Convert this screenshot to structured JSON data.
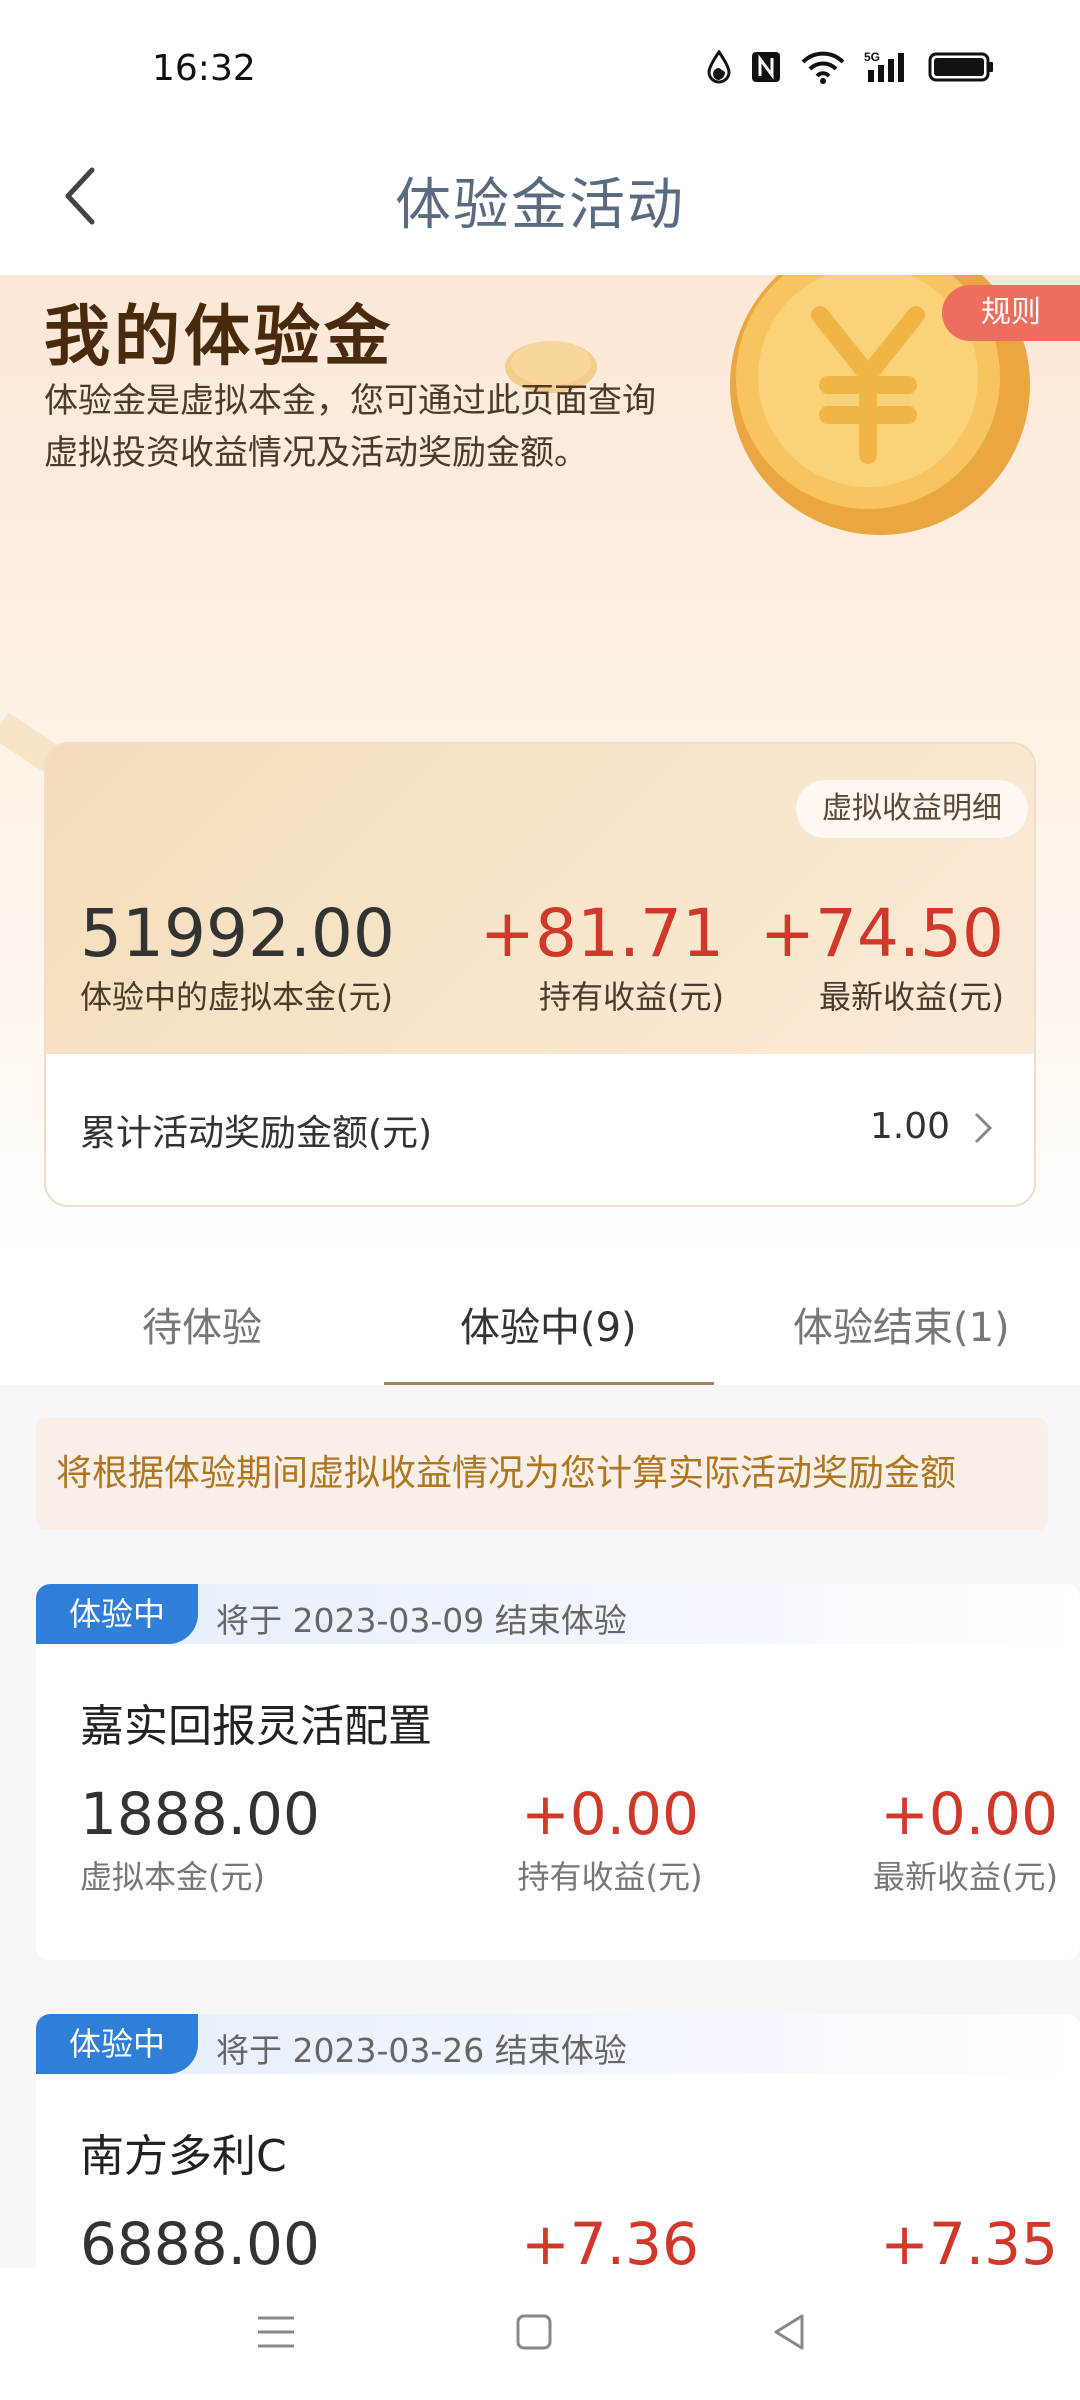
{
  "status_bar": {
    "time": "16:32"
  },
  "nav": {
    "title": "体验金活动"
  },
  "hero": {
    "title": "我的体验金",
    "description": "体验金是虚拟本金，您可通过此页面查询虚拟投资收益情况及活动奖励金额。",
    "rules_label": "规则"
  },
  "summary": {
    "detail_label": "虚拟收益明细",
    "principal_value": "51992.00",
    "principal_label": "体验中的虚拟本金(元)",
    "hold_value": "+81.71",
    "hold_label": "持有收益(元)",
    "latest_value": "+74.50",
    "latest_label": "最新收益(元)",
    "reward_label": "累计活动奖励金额(元)",
    "reward_value": "1.00"
  },
  "tabs": [
    {
      "label": "待体验"
    },
    {
      "label": "体验中(9)"
    },
    {
      "label": "体验结束(1)"
    }
  ],
  "notice": "将根据体验期间虚拟收益情况为您计算实际活动奖励金额",
  "funds": [
    {
      "status": "体验中",
      "end_text": "将于 2023-03-09 结束体验",
      "name": "嘉实回报灵活配置",
      "principal": "1888.00",
      "principal_label": "虚拟本金(元)",
      "hold": "+0.00",
      "hold_label": "持有收益(元)",
      "latest": "+0.00",
      "latest_label": "最新收益(元)"
    },
    {
      "status": "体验中",
      "end_text": "将于 2023-03-26 结束体验",
      "name": "南方多利C",
      "principal": "6888.00",
      "hold": "+7.36",
      "latest": "+7.35"
    }
  ],
  "colors": {
    "accent_red": "#d0382a",
    "tag_blue": "#2f7ed8",
    "notice_text": "#b0751f",
    "rules_bg": "#ec6e5e"
  }
}
